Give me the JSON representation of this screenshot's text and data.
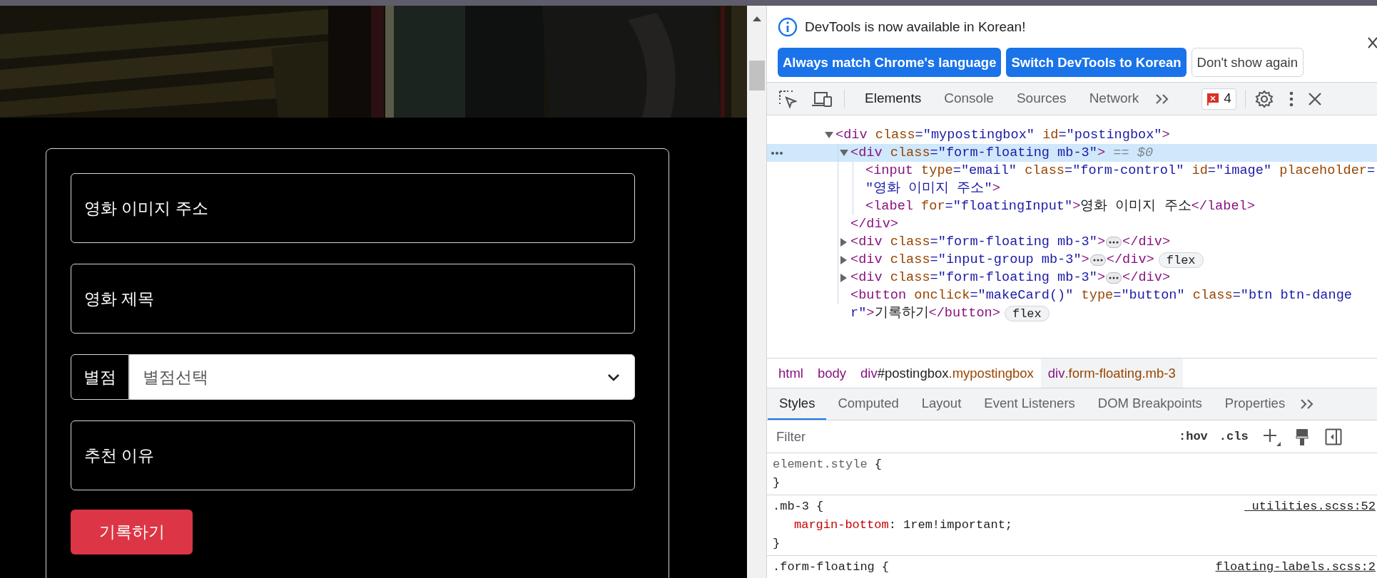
{
  "page": {
    "form": {
      "fields": [
        {
          "kind": "floating",
          "placeholder": "영화 이미지 주소"
        },
        {
          "kind": "floating",
          "placeholder": "영화 제목"
        },
        {
          "kind": "select",
          "label": "별점",
          "value": "별점선택"
        },
        {
          "kind": "floating",
          "placeholder": "추천 이유"
        }
      ],
      "submit": "기록하기"
    }
  },
  "devtools": {
    "notice": {
      "text": "DevTools is now available in Korean!",
      "buttons": [
        {
          "label": "Always match Chrome's language",
          "kind": "primary"
        },
        {
          "label": "Switch DevTools to Korean",
          "kind": "primary"
        },
        {
          "label": "Don't show again",
          "kind": "secondary"
        }
      ]
    },
    "tabs": [
      {
        "label": "Elements",
        "selected": true
      },
      {
        "label": "Console",
        "selected": false
      },
      {
        "label": "Sources",
        "selected": false
      },
      {
        "label": "Network",
        "selected": false
      }
    ],
    "error_count": "4",
    "tree": [
      {
        "kind": "open",
        "selected": false,
        "tokens": [
          {
            "kind": "tag",
            "text": "<div"
          },
          {
            "kind": "attr",
            "text": " class"
          },
          {
            "kind": "val",
            "text": "=\"mypostingbox\""
          },
          {
            "kind": "attr",
            "text": " id"
          },
          {
            "kind": "val",
            "text": "=\"postingbox\""
          },
          {
            "kind": "tag",
            "text": ">"
          }
        ],
        "children": [
          {
            "kind": "open",
            "selected": true,
            "tokens": [
              {
                "kind": "tag",
                "text": "<div"
              },
              {
                "kind": "attr",
                "text": " class"
              },
              {
                "kind": "val",
                "text": "=\"form-floating mb-3\""
              },
              {
                "kind": "tag",
                "text": ">"
              },
              {
                "kind": "dim",
                "text": " == $0"
              }
            ],
            "children": [
              {
                "kind": "leaf",
                "selected": false,
                "tokens": [
                  {
                    "kind": "tag",
                    "text": "<input"
                  },
                  {
                    "kind": "attr",
                    "text": " type"
                  },
                  {
                    "kind": "val",
                    "text": "=\"email\""
                  },
                  {
                    "kind": "attr",
                    "text": " class"
                  },
                  {
                    "kind": "val",
                    "text": "=\"form-control\""
                  },
                  {
                    "kind": "attr",
                    "text": " id"
                  },
                  {
                    "kind": "val",
                    "text": "=\"image\""
                  },
                  {
                    "kind": "attr",
                    "text": " placeholder"
                  },
                  {
                    "kind": "val",
                    "text": "="
                  },
                  {
                    "kind": "br"
                  },
                  {
                    "kind": "val",
                    "text": "\"영화 이미지 주소\""
                  },
                  {
                    "kind": "tag",
                    "text": ">"
                  }
                ]
              },
              {
                "kind": "leaf",
                "selected": false,
                "tokens": [
                  {
                    "kind": "tag",
                    "text": "<label"
                  },
                  {
                    "kind": "attr",
                    "text": " for"
                  },
                  {
                    "kind": "val",
                    "text": "=\"floatingInput\""
                  },
                  {
                    "kind": "tag",
                    "text": ">"
                  },
                  {
                    "kind": "text",
                    "text": "영화 이미지 주소"
                  },
                  {
                    "kind": "tag",
                    "text": "</label>"
                  }
                ]
              }
            ],
            "close": "</div>"
          },
          {
            "kind": "closed",
            "selected": false,
            "tokens": [
              {
                "kind": "tag",
                "text": "<div"
              },
              {
                "kind": "attr",
                "text": " class"
              },
              {
                "kind": "val",
                "text": "=\"form-floating mb-3\""
              },
              {
                "kind": "tag",
                "text": ">"
              },
              {
                "kind": "more"
              },
              {
                "kind": "tag",
                "text": "</div>"
              }
            ]
          },
          {
            "kind": "closed",
            "selected": false,
            "tokens": [
              {
                "kind": "tag",
                "text": "<div"
              },
              {
                "kind": "attr",
                "text": " class"
              },
              {
                "kind": "val",
                "text": "=\"input-group mb-3\""
              },
              {
                "kind": "tag",
                "text": ">"
              },
              {
                "kind": "more"
              },
              {
                "kind": "tag",
                "text": "</div>"
              },
              {
                "kind": "badge",
                "text": "flex"
              }
            ]
          },
          {
            "kind": "closed",
            "selected": false,
            "tokens": [
              {
                "kind": "tag",
                "text": "<div"
              },
              {
                "kind": "attr",
                "text": " class"
              },
              {
                "kind": "val",
                "text": "=\"form-floating mb-3\""
              },
              {
                "kind": "tag",
                "text": ">"
              },
              {
                "kind": "more"
              },
              {
                "kind": "tag",
                "text": "</div>"
              }
            ]
          },
          {
            "kind": "leaf",
            "selected": false,
            "tokens": [
              {
                "kind": "tag",
                "text": "<button"
              },
              {
                "kind": "attr",
                "text": " onclick"
              },
              {
                "kind": "val",
                "text": "=\"makeCard()\""
              },
              {
                "kind": "attr",
                "text": " type"
              },
              {
                "kind": "val",
                "text": "=\"button\""
              },
              {
                "kind": "attr",
                "text": " class"
              },
              {
                "kind": "val",
                "text": "=\"btn btn-dange"
              },
              {
                "kind": "br"
              },
              {
                "kind": "val",
                "text": "r\""
              },
              {
                "kind": "tag",
                "text": ">"
              },
              {
                "kind": "text",
                "text": "기록하기"
              },
              {
                "kind": "tag",
                "text": "</button>"
              },
              {
                "kind": "badge",
                "text": "flex"
              }
            ]
          }
        ]
      }
    ],
    "breadcrumb": [
      {
        "selected": false,
        "parts": [
          {
            "kind": "tag",
            "text": "html"
          }
        ]
      },
      {
        "selected": false,
        "parts": [
          {
            "kind": "tag",
            "text": "body"
          }
        ]
      },
      {
        "selected": false,
        "parts": [
          {
            "kind": "tag",
            "text": "div"
          },
          {
            "kind": "text",
            "text": "#postingbox"
          },
          {
            "kind": "attr",
            "text": ".mypostingbox"
          }
        ]
      },
      {
        "selected": true,
        "parts": [
          {
            "kind": "tag",
            "text": "div"
          },
          {
            "kind": "attr",
            "text": ".form-floating.mb-3"
          }
        ]
      }
    ],
    "subtabs": [
      {
        "label": "Styles",
        "selected": true
      },
      {
        "label": "Computed",
        "selected": false
      },
      {
        "label": "Layout",
        "selected": false
      },
      {
        "label": "Event Listeners",
        "selected": false
      },
      {
        "label": "DOM Breakpoints",
        "selected": false
      },
      {
        "label": "Properties",
        "selected": false
      }
    ],
    "filter": {
      "placeholder": "Filter"
    },
    "filter_tools": [
      ":hov",
      ".cls"
    ],
    "rules": [
      {
        "kind": "inline",
        "selector": "element.style",
        "brace": "{",
        "close": "}"
      },
      {
        "kind": "rule",
        "selector": ".mb-3",
        "brace": "{",
        "source": "_utilities.scss:52",
        "declarations": [
          {
            "property": "margin-bottom",
            "value": ": 1rem!important;"
          }
        ],
        "close": "}"
      },
      {
        "kind": "rule",
        "selector": ".form-floating",
        "brace": "{",
        "source": "floating-labels.scss:2"
      }
    ]
  }
}
